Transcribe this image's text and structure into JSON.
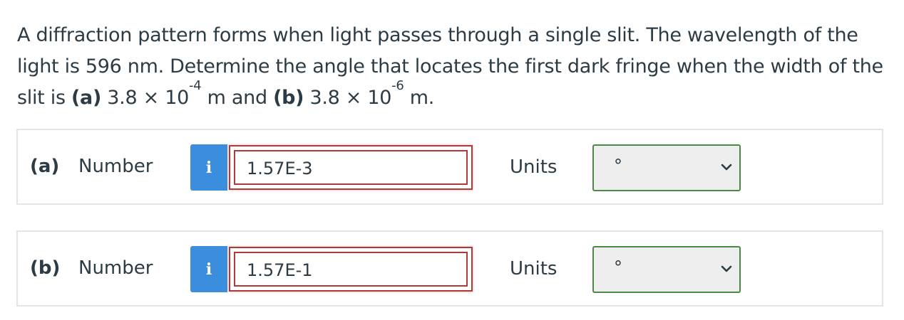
{
  "question": {
    "text_before": "A diffraction pattern forms when light passes through a single slit. The wavelength of the light is 596 nm. Determine the angle that locates the first dark fringe when the width of the slit is ",
    "part_a_label": "(a)",
    "part_a_base": " 3.8 × 10",
    "part_a_exp": "-4",
    "part_a_unit": " m and ",
    "part_b_label": "(b)",
    "part_b_base": " 3.8 × 10",
    "part_b_exp": "-6",
    "part_b_unit": " m."
  },
  "answers": [
    {
      "part": "(a)",
      "number_label": "Number",
      "info_icon": "info-icon",
      "value": "1.57E-3",
      "units_label": "Units",
      "units_value": "°"
    },
    {
      "part": "(b)",
      "number_label": "Number",
      "info_icon": "info-icon",
      "value": "1.57E-1",
      "units_label": "Units",
      "units_value": "°"
    }
  ],
  "colors": {
    "info_button": "#3b8dde",
    "input_border": "#b03a3a",
    "select_border": "#4a8a45",
    "select_bg": "#eeeeee"
  }
}
